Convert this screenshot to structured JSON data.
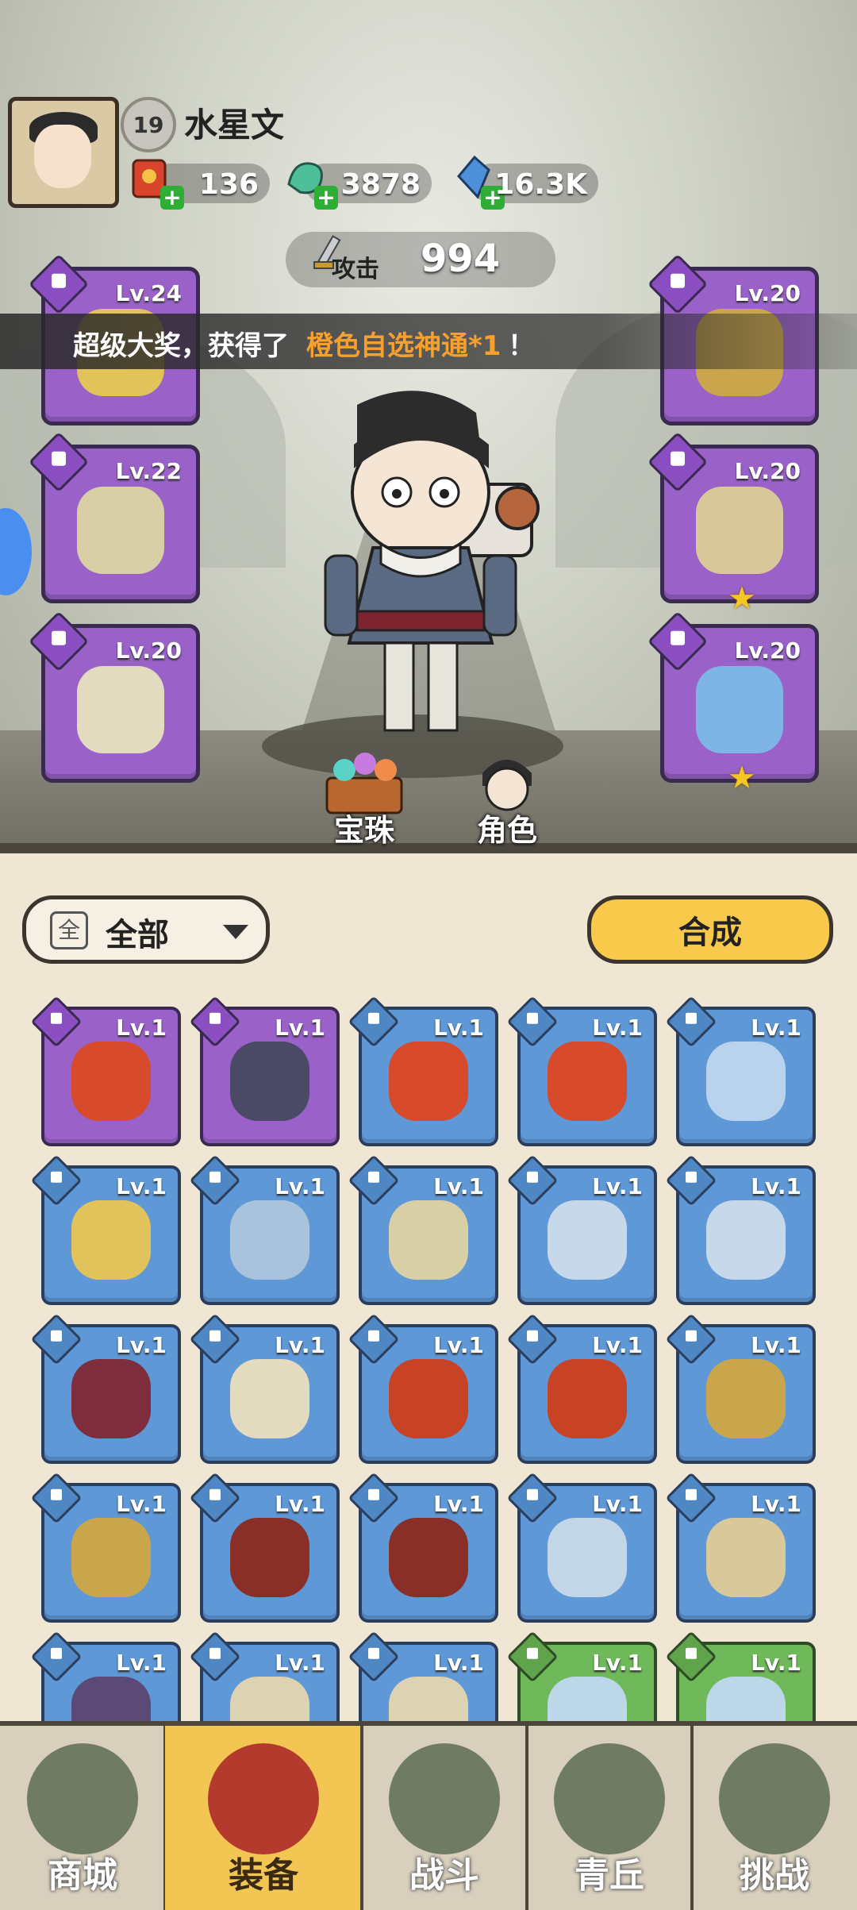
{
  "player": {
    "name": "水星文",
    "level": "19"
  },
  "resources": [
    {
      "icon": "red-envelope-icon",
      "value": "136"
    },
    {
      "icon": "jade-dragon-icon",
      "value": "3878"
    },
    {
      "icon": "crystal-icon",
      "value": "16.3K"
    }
  ],
  "attack": {
    "label": "攻击",
    "value": "994"
  },
  "announcement": {
    "prefix": "超级大奖，获得了 ",
    "highlight": "橙色自选神通*1",
    "suffix": "！"
  },
  "equipped_left": [
    {
      "level": "Lv.24",
      "type": "sword",
      "item": "flame-whip-icon"
    },
    {
      "level": "Lv.22",
      "type": "armor",
      "item": "bone-armor-icon"
    },
    {
      "level": "Lv.20",
      "type": "ring",
      "item": "feather-shield-icon"
    }
  ],
  "equipped_right": [
    {
      "level": "Lv.20",
      "type": "belt",
      "item": "gold-belt-icon",
      "star": false
    },
    {
      "level": "Lv.20",
      "type": "boots",
      "item": "bone-boots-icon",
      "star": true
    },
    {
      "level": "Lv.20",
      "type": "amulet",
      "item": "blue-amulet-icon",
      "star": true
    }
  ],
  "actions": {
    "gems": "宝珠",
    "role": "角色"
  },
  "filter": {
    "icon_text": "全",
    "label": "全部"
  },
  "synthesize": "合成",
  "inventory": [
    {
      "level": "Lv.1",
      "rarity": "purple",
      "item": "flame-whip-icon",
      "color": "#d84a2c"
    },
    {
      "level": "Lv.1",
      "rarity": "purple",
      "item": "dark-belt-icon",
      "color": "#4a4a66"
    },
    {
      "level": "Lv.1",
      "rarity": "blue",
      "item": "flame-whip-icon",
      "color": "#d84a2c"
    },
    {
      "level": "Lv.1",
      "rarity": "blue",
      "item": "flame-whip-icon",
      "color": "#d84a2c"
    },
    {
      "level": "Lv.1",
      "rarity": "blue",
      "item": "ice-bow-icon",
      "color": "#b9d3ee"
    },
    {
      "level": "Lv.1",
      "rarity": "blue",
      "item": "gold-staff-icon",
      "color": "#e2c25a"
    },
    {
      "level": "Lv.1",
      "rarity": "blue",
      "item": "ice-armor-icon",
      "color": "#a9c3dd"
    },
    {
      "level": "Lv.1",
      "rarity": "blue",
      "item": "bone-armor-icon",
      "color": "#d9cfa6"
    },
    {
      "level": "Lv.1",
      "rarity": "blue",
      "item": "ice-claw-icon",
      "color": "#c7d8ea"
    },
    {
      "level": "Lv.1",
      "rarity": "blue",
      "item": "ice-claw-icon",
      "color": "#c7d8ea"
    },
    {
      "level": "Lv.1",
      "rarity": "blue",
      "item": "crimson-claw-icon",
      "color": "#7d2d3c"
    },
    {
      "level": "Lv.1",
      "rarity": "blue",
      "item": "feather-shield-icon",
      "color": "#e3dbc0"
    },
    {
      "level": "Lv.1",
      "rarity": "blue",
      "item": "flame-belt-icon",
      "color": "#c84226"
    },
    {
      "level": "Lv.1",
      "rarity": "blue",
      "item": "flame-belt-icon",
      "color": "#c84226"
    },
    {
      "level": "Lv.1",
      "rarity": "blue",
      "item": "gold-belt-icon",
      "color": "#c9a54c"
    },
    {
      "level": "Lv.1",
      "rarity": "blue",
      "item": "gold-belt-icon",
      "color": "#c9a54c"
    },
    {
      "level": "Lv.1",
      "rarity": "blue",
      "item": "flame-boots-icon",
      "color": "#8a2f27"
    },
    {
      "level": "Lv.1",
      "rarity": "blue",
      "item": "flame-boots-icon",
      "color": "#8a2f27"
    },
    {
      "level": "Lv.1",
      "rarity": "blue",
      "item": "ice-boots-icon",
      "color": "#c3d6e8"
    },
    {
      "level": "Lv.1",
      "rarity": "blue",
      "item": "bone-boots-icon",
      "color": "#d9c99a"
    },
    {
      "level": "Lv.1",
      "rarity": "blue",
      "item": "dark-orb-amulet-icon",
      "color": "#5b4a78"
    },
    {
      "level": "Lv.1",
      "rarity": "blue",
      "item": "bone-amulet-icon",
      "color": "#ddd2b1"
    },
    {
      "level": "Lv.1",
      "rarity": "blue",
      "item": "bone-amulet-icon",
      "color": "#ddd2b1"
    },
    {
      "level": "Lv.1",
      "rarity": "green",
      "item": "green-bow-icon",
      "color": "#bcd7e8"
    },
    {
      "level": "Lv.1",
      "rarity": "green",
      "item": "green-bow-icon",
      "color": "#bcd7e8"
    }
  ],
  "nav": [
    {
      "label": "商城",
      "icon": "shop-pavilion-icon",
      "active": false
    },
    {
      "label": "装备",
      "icon": "helmet-icon",
      "active": true
    },
    {
      "label": "战斗",
      "icon": "crossed-swords-icon",
      "active": false
    },
    {
      "label": "青丘",
      "icon": "mountain-icon",
      "active": false
    },
    {
      "label": "挑战",
      "icon": "challenge-orb-icon",
      "active": false
    }
  ],
  "colors": {
    "announce_highlight": "#f6a02e",
    "synth_button": "#f8c94b",
    "nav_active": "#f3c552",
    "purple_slot": "#9a62c9",
    "blue_slot": "#5e98d6",
    "green_slot": "#6fb95a"
  }
}
